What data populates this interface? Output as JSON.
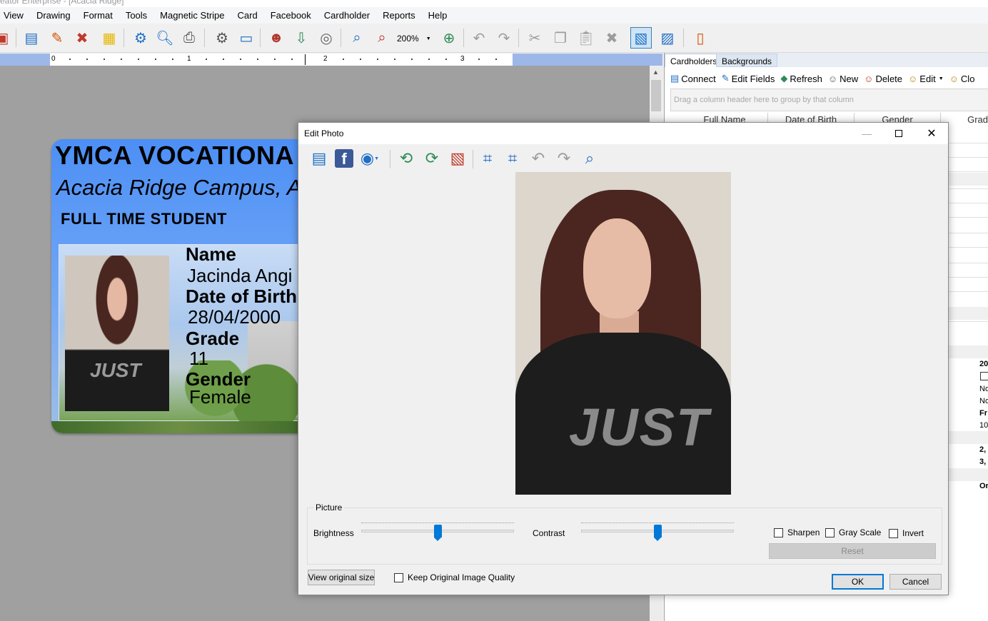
{
  "app": {
    "title": "eator Enterprise - [Acacia Ridge]"
  },
  "menu": [
    "View",
    "Drawing",
    "Format",
    "Tools",
    "Magnetic Stripe",
    "Card",
    "Facebook",
    "Cardholder",
    "Reports",
    "Help"
  ],
  "toolbar": {
    "zoom": "200%"
  },
  "ruler": {
    "marks": [
      "0",
      "1",
      "2",
      "3"
    ]
  },
  "card": {
    "title": "YMCA VOCATIONA",
    "campus": "Acacia Ridge Campus, A",
    "status": "FULL TIME STUDENT",
    "name_label": "Name",
    "name_value": "Jacinda Angi",
    "dob_label": "Date of Birth",
    "dob_value": "28/04/2000",
    "grade_label": "Grade",
    "grade_value": "11",
    "gender_label": "Gender",
    "gender_value": "Female",
    "shirt_text": "JUST"
  },
  "right_pane": {
    "tabs": [
      "Cardholders",
      "Backgrounds"
    ],
    "buttons": [
      "Connect",
      "Edit Fields",
      "Refresh",
      "New",
      "Delete",
      "Edit",
      "Clo"
    ],
    "group_hint": "Drag a column header here to group by that column",
    "columns": [
      "Full Name",
      "Date of Birth",
      "Gender",
      "Grad"
    ],
    "props": [
      "20",
      "No",
      "No",
      "Fr",
      "10",
      "2,",
      "3,",
      "Or"
    ]
  },
  "dialog": {
    "title": "Edit Photo",
    "group_label": "Picture",
    "brightness_label": "Brightness",
    "brightness_value": 0.5,
    "contrast_label": "Contrast",
    "contrast_value": 0.5,
    "sharpen_label": "Sharpen",
    "grayscale_label": "Gray Scale",
    "invert_label": "Invert",
    "reset_label": "Reset",
    "view_original_label": "View original size",
    "keep_quality_label": "Keep Original Image Quality",
    "ok_label": "OK",
    "cancel_label": "Cancel",
    "photo_shirt_text": "JUST"
  }
}
